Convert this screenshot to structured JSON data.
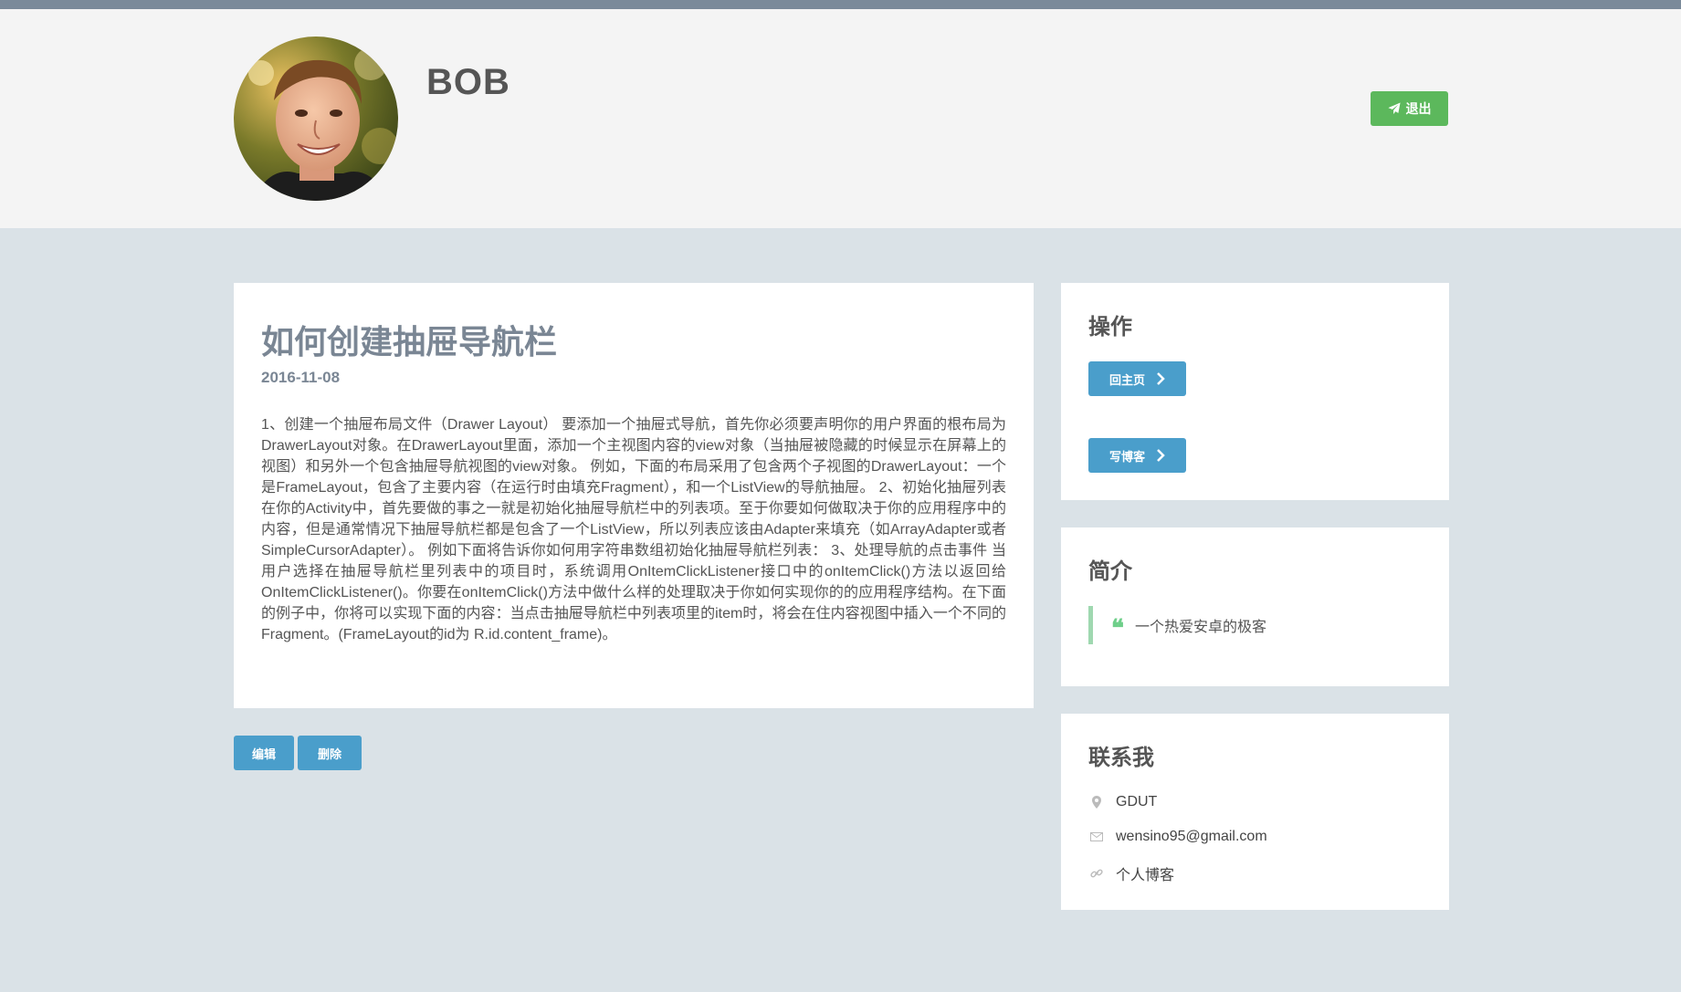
{
  "profile": {
    "username": "BOB",
    "logout_label": "退出"
  },
  "article": {
    "title": "如何创建抽屉导航栏",
    "date": "2016-11-08",
    "body": "1、创建一个抽屉布局文件（Drawer Layout） 要添加一个抽屉式导航，首先你必须要声明你的用户界面的根布局为DrawerLayout对象。在DrawerLayout里面，添加一个主视图内容的view对象（当抽屉被隐藏的时候显示在屏幕上的视图）和另外一个包含抽屉导航视图的view对象。 例如，下面的布局采用了包含两个子视图的DrawerLayout：一个是FrameLayout，包含了主要内容（在运行时由填充Fragment），和一个ListView的导航抽屉。 2、初始化抽屉列表 在你的Activity中，首先要做的事之一就是初始化抽屉导航栏中的列表项。至于你要如何做取决于你的应用程序中的内容，但是通常情况下抽屉导航栏都是包含了一个ListView，所以列表应该由Adapter来填充（如ArrayAdapter或者SimpleCursorAdapter）。 例如下面将告诉你如何用字符串数组初始化抽屉导航栏列表： 3、处理导航的点击事件 当用户选择在抽屉导航栏里列表中的项目时，系统调用OnItemClickListener接口中的onItemClick()方法以返回给OnItemClickListener()。你要在onItemClick()方法中做什么样的处理取决于你如何实现你的的应用程序结构。在下面的例子中，你将可以实现下面的内容：当点击抽屉导航栏中列表项里的item时，将会在住内容视图中插入一个不同的Fragment。(FrameLayout的id为 R.id.content_frame)。",
    "edit_label": "编辑",
    "delete_label": "删除"
  },
  "sidebar": {
    "actions": {
      "title": "操作",
      "home_label": "回主页",
      "write_label": "写博客"
    },
    "intro": {
      "title": "简介",
      "quote": "一个热爱安卓的极客",
      "quote_mark": "❝"
    },
    "contact": {
      "title": "联系我",
      "location": "GDUT",
      "email": "wensino95@gmail.com",
      "blog": "个人博客"
    }
  },
  "colors": {
    "topbar": "#7a8a9a",
    "header_bg": "#f4f4f4",
    "page_bg": "#dae2e7",
    "success": "#5cb85c",
    "primary": "#4a9ecb",
    "quote_border": "#9fd8b0"
  },
  "icons": {
    "logout": "paper-plane-icon",
    "side_buttons": "chevron-right-icon",
    "location": "map-marker-icon",
    "email": "envelope-icon",
    "blog": "link-icon"
  }
}
